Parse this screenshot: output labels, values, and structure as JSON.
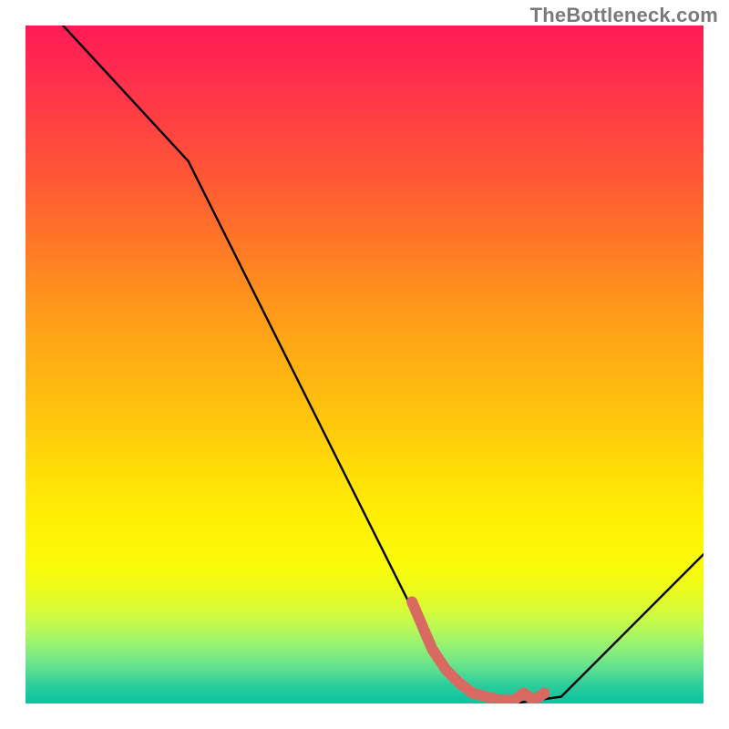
{
  "watermark": "TheBottleneck.com",
  "chart_data": {
    "type": "line",
    "title": "",
    "xlabel": "",
    "ylabel": "",
    "xlim": [
      0,
      100
    ],
    "ylim": [
      0,
      100
    ],
    "grid": false,
    "series": [
      {
        "name": "bottleneck-curve",
        "color": "#000000",
        "x": [
          0,
          24,
          60,
          66,
          72,
          79,
          100
        ],
        "values": [
          106,
          80,
          8,
          1,
          0,
          1,
          22
        ]
      },
      {
        "name": "highlight-segment",
        "color": "#d96a62",
        "x": [
          57,
          60,
          62,
          64,
          66,
          68,
          70,
          72,
          73.5,
          75,
          76.5
        ],
        "values": [
          15,
          8,
          5,
          3,
          1.5,
          1,
          0.5,
          0.5,
          1.5,
          0.5,
          1.5
        ]
      }
    ],
    "background_gradient": {
      "top": "#ff1a55",
      "mid": "#ffdd00",
      "bottom": "#0bc49f"
    }
  }
}
